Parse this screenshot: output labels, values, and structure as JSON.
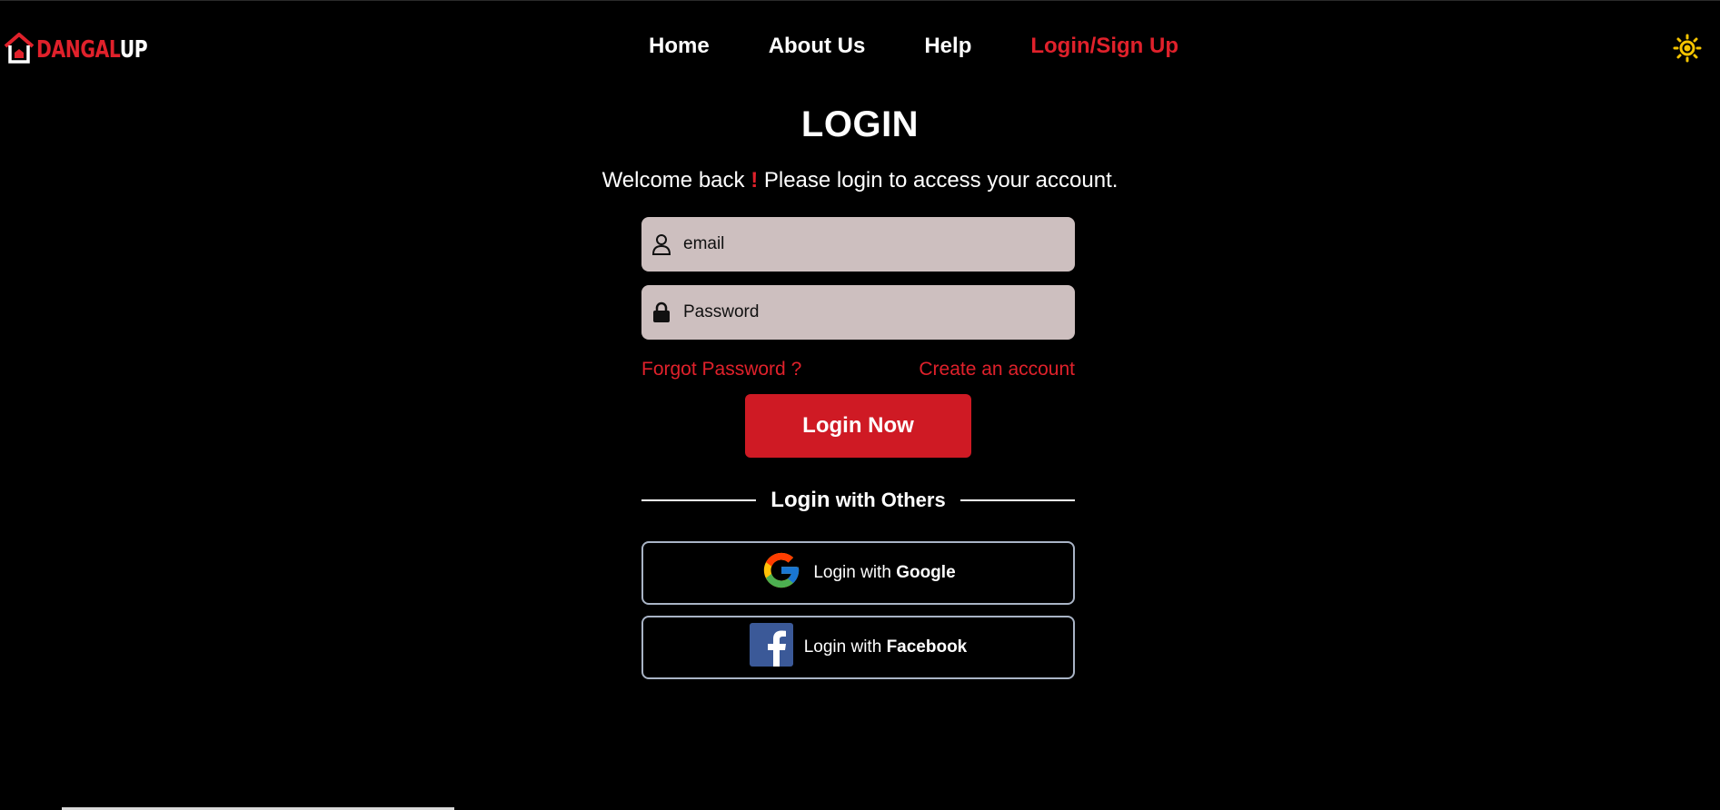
{
  "brand": {
    "logo_part1": "DANGAL",
    "logo_part2": "UP"
  },
  "nav": {
    "items": [
      {
        "label": "Home"
      },
      {
        "label": "About Us"
      },
      {
        "label": "Help"
      },
      {
        "label": "Login/Sign Up"
      }
    ],
    "theme_icon": "sun-icon"
  },
  "login": {
    "title": "LOGIN",
    "subtitle_before": "Welcome back ",
    "subtitle_bang": "!",
    "subtitle_after": " Please login to access your account.",
    "email_placeholder": "email",
    "password_placeholder": "Password",
    "forgot_password": "Forgot Password ?",
    "create_account": "Create an account",
    "submit": "Login Now",
    "divider_label_1": "Login",
    "divider_label_2": " with Others",
    "google_prefix": "Login with ",
    "google_name": "Google",
    "facebook_prefix": "Login with ",
    "facebook_name": "Facebook"
  },
  "colors": {
    "accent": "#e0212b",
    "button": "#cf1a24",
    "input_bg": "#cdbfbf",
    "background": "#000000",
    "sun": "#f5c400"
  }
}
